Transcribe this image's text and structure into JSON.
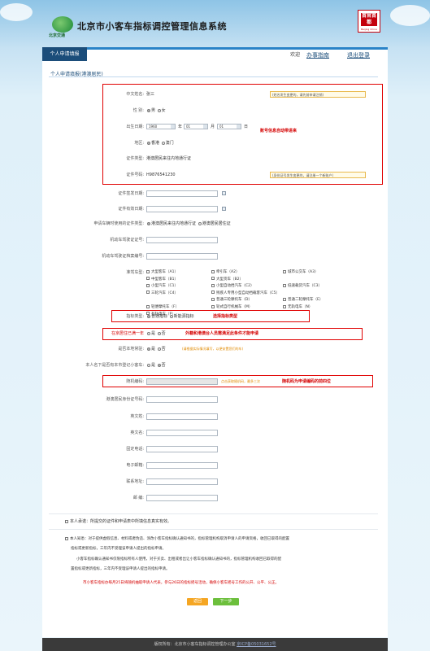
{
  "header": {
    "title": "北京市小客车指标调控管理信息系统",
    "logo_text": "北京交通",
    "seal_text": "首官首都",
    "seal_sub": "Beijing China"
  },
  "nav": {
    "tab": "个人申请填报",
    "welcome": "欢迎 ",
    "link_guide": "办事指南",
    "link_logout": "退出登录"
  },
  "section_title": "个人申请填报(港澳居民)",
  "fields": {
    "name_label": "中文姓名:",
    "name_value": "张三",
    "name_note": "(姓名发生变更的，请先前申请注销)",
    "gender_label": "性    别:",
    "gender_male": "男",
    "gender_female": "女",
    "birth_label": "出生日期:",
    "birth_year": "1960",
    "birth_year_unit": "年",
    "birth_month": "01",
    "birth_month_unit": "月",
    "birth_day": "01",
    "birth_day_unit": "日",
    "region_label": "地区:",
    "region_hk": "香港",
    "region_macau": "澳门",
    "cert_type_label": "证件类型:",
    "cert_type_value": "港澳居民来往内地通行证",
    "cert_no_label": "证件号码:",
    "cert_no_value": "H9876541230",
    "cert_no_note": "(身份证号发生变更的，请注册一个新账户)",
    "issue_date_label": "证件签发日期:",
    "expire_date_label": "证件有效日期:",
    "resident_cert_label": "申请车辆时使用的证件类型:",
    "resident_opt1": "港澳居民来往内地通行证",
    "resident_opt2": "港澳居民居住证",
    "driver_license_label": "机动车驾驶证证号:",
    "driver_archive_label": "机动车驾驶证档案编号:",
    "vehicle_type_label": "准驾车型:",
    "indicator_type_label": "指标类型:",
    "indicator_normal": "普通指标",
    "indicator_new_energy": "新能源指标",
    "live_year_label": "在京居住已满一年",
    "live_yes": "是",
    "live_no": "否",
    "local_label": "是否本地常驻:",
    "local_yes": "是",
    "local_no": "否",
    "local_note": "(请根据实际情况填写，以便安置您们的车)",
    "own_car_label": "本人名下是否有本市登记小客车:",
    "own_yes": "是",
    "own_no": "否",
    "random_label": "随机编码:",
    "random_note": "点击获取随机码，最多三次",
    "hk_id_label": "港澳居民身份证号码:",
    "en_last_label": "英文姓:",
    "en_first_label": "英文名:",
    "phone_label": "固定电话:",
    "email_label": "电子邮箱:",
    "address_label": "联系地址:",
    "zip_label": "邮    编:"
  },
  "vehicles": [
    [
      "大型客车（A1）",
      "牵引车（A2）",
      "城市公交车（A3）"
    ],
    [
      "中型客车（B1）",
      "大型货车（B2）",
      ""
    ],
    [
      "小型汽车（C1）",
      "小型自动挡汽车（C2）",
      "低速载货汽车（C3）"
    ],
    [
      "三轮汽车（C4）",
      "残疾人专用小型自动挡载客汽车（C5）",
      ""
    ],
    [
      "",
      "普通三轮摩托车（D）",
      "普通二轮摩托车（E）"
    ],
    [
      "轻便摩托车（F）",
      "轮式自行机械车（M）",
      "无轨电车（N）"
    ],
    [
      "有轨电车（P）",
      "",
      ""
    ]
  ],
  "annotations": {
    "auto_fill": "账号信息自动带进来",
    "choose_type": "选择指标类型",
    "foreign_rule": "外籍和港澳台人员需满足此条件才能申请",
    "random_hint": "随机码为申请编码的前四位"
  },
  "declarations": {
    "decl1": "本人承诺：所提交的证件和申请表中所填信息真实有效。",
    "decl2_a": "本人知悉：对于提供虚假信息、材料或者伪造、涂改小客车指标确认通知书的，指标管理机构取消申请人的申请资格，收回已取得的配置",
    "decl2_b": "指标或更新指标，三年内不受理该申请人提出的指标申请。",
    "decl2_c": "小客车指标确认通知书仅限指标所有人使用，对于买卖、出租或者出让小客车指标确认通知书的，指标管理机构收回已取得的配",
    "decl2_d": "置指标或更新指标，三年内不受理该申请人提出的指标申请。"
  },
  "notice": "市小客车指标办每月25日将随机抽取申请人代表，参与26日的指标摇号活动，确保小客车摇号工作的公开、公平、公正。",
  "buttons": {
    "back": "返回",
    "next": "下一步"
  },
  "footer": {
    "text": "版权所有：北京市小客车指标调控管理办公室  ",
    "icp": "京ICP备05031652号"
  },
  "colors": {
    "accent": "#1b4d7a",
    "highlight": "#e00000",
    "back_button": "#f5a623",
    "next_button": "#6cbf3c"
  }
}
